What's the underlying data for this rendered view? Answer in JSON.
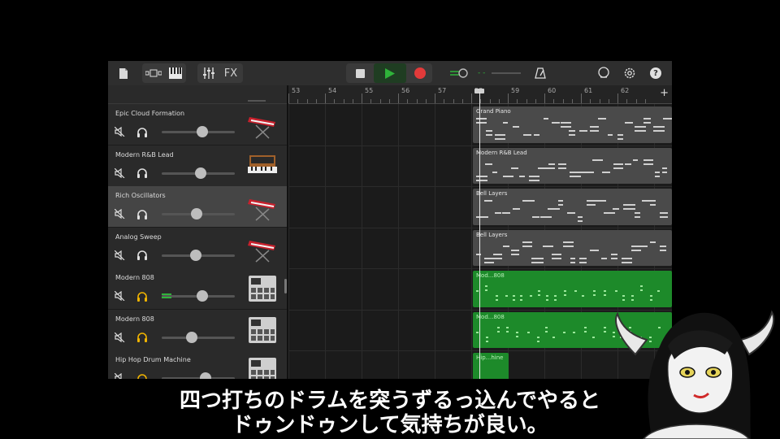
{
  "toolbar": {
    "fx_label": "FX",
    "icons": [
      "document-icon",
      "tracks-view-icon",
      "keyboard-icon",
      "mixer-icon",
      "fx-icon",
      "stop-icon",
      "play-icon",
      "record-icon",
      "master-volume-icon",
      "metronome-icon",
      "loop-icon",
      "settings-icon",
      "help-icon"
    ],
    "level_display": "- -",
    "help_label": "?"
  },
  "ruler": {
    "bars": [
      "53",
      "54",
      "55",
      "56",
      "57",
      "58",
      "59",
      "60",
      "61",
      "62"
    ],
    "add_label": "+"
  },
  "tracks": [
    {
      "name": "Epic Cloud Formation",
      "volume": 0.55,
      "instrument": "red-synth-keyboard",
      "headphone": "off",
      "selected": false
    },
    {
      "name": "Modern R&B Lead",
      "volume": 0.53,
      "instrument": "vintage-synth",
      "headphone": "off",
      "selected": false
    },
    {
      "name": "Rich Oscillators",
      "volume": 0.48,
      "instrument": "red-synth-keyboard",
      "headphone": "off",
      "selected": true
    },
    {
      "name": "Analog Sweep",
      "volume": 0.47,
      "instrument": "red-synth-keyboard",
      "headphone": "off",
      "selected": false
    },
    {
      "name": "Modern 808",
      "volume": 0.56,
      "instrument": "drum-machine",
      "headphone": "on",
      "selected": false
    },
    {
      "name": "Modern 808",
      "volume": 0.41,
      "instrument": "drum-machine",
      "headphone": "on",
      "selected": false
    },
    {
      "name": "Hip Hop Drum Machine",
      "volume": 0.6,
      "instrument": "drum-machine",
      "headphone": "on",
      "selected": false
    }
  ],
  "regions": [
    {
      "label": "Grand Piano",
      "color": "gray"
    },
    {
      "label": "Modern R&B Lead",
      "color": "gray"
    },
    {
      "label": "Bell Layers",
      "color": "gray"
    },
    {
      "label": "Bell Layers",
      "color": "gray"
    },
    {
      "label": "Mod...808",
      "color": "green"
    },
    {
      "label": "Mod...808",
      "color": "green"
    },
    {
      "label": "Hip...hine",
      "color": "green"
    }
  ],
  "colors": {
    "accent_green": "#2fb33a",
    "record_red": "#e23a3a",
    "headphone_active": "#f1b400",
    "region_green": "#1d8a2a"
  },
  "subtitle": {
    "line1": "四つ打ちのドラムを突うずるっ込んでやると",
    "line2": "ドゥンドゥンして気持ちが良い。"
  }
}
